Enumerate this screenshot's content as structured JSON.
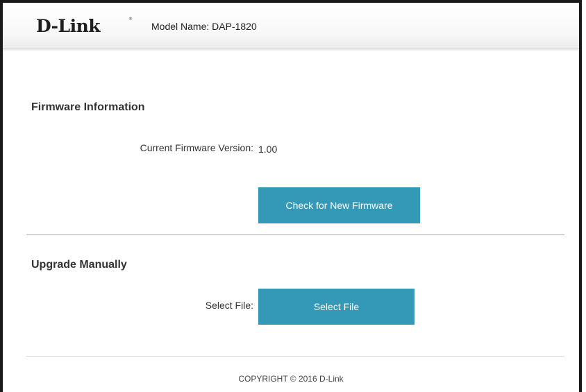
{
  "header": {
    "logo_text": "D-Link",
    "logo_mark": "®",
    "model_name": "Model Name: DAP-1820"
  },
  "firmware_info": {
    "title": "Firmware Information",
    "version_label": "Current Firmware Version:",
    "version_value": "1.00",
    "check_button_label": "Check for New Firmware"
  },
  "upgrade_manually": {
    "title": "Upgrade Manually",
    "select_label": "Select File:",
    "select_button_label": "Select File"
  },
  "footer": {
    "copyright": "COPYRIGHT © 2016 D-Link"
  },
  "colors": {
    "accent": "#3498b7",
    "text": "#333333"
  }
}
